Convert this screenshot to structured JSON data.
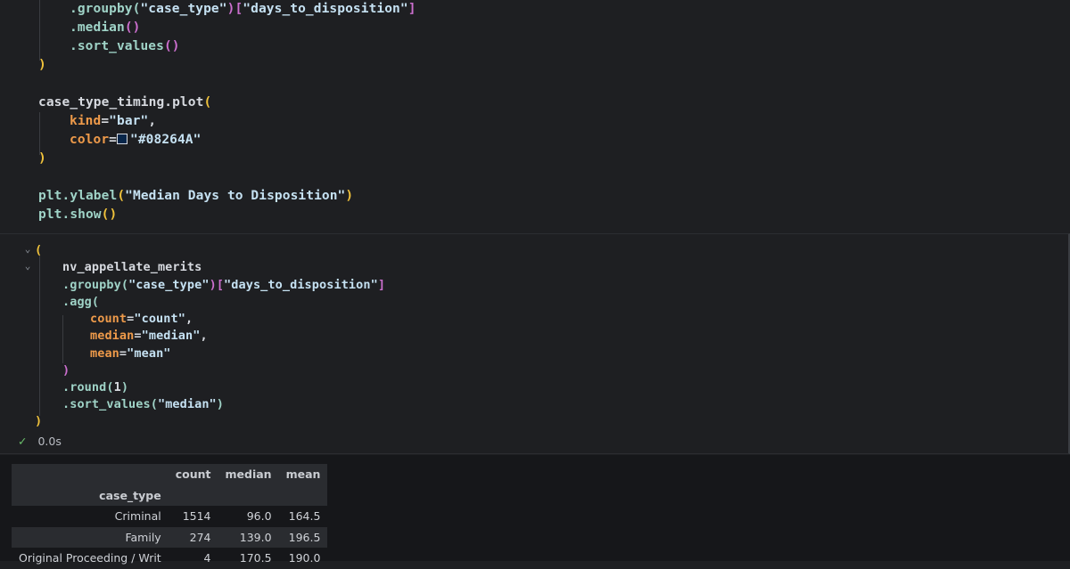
{
  "cell1": {
    "lines": [
      [
        ".groupby(",
        "\"case_type\"",
        ")",
        "[",
        "\"days_to_disposition\"",
        "]"
      ],
      [
        ".median",
        "()"
      ],
      [
        ".sort_values",
        "()"
      ],
      [
        ")"
      ],
      [
        "case_type_timing.plot",
        "("
      ],
      [
        "kind",
        "=",
        "\"bar\"",
        ","
      ],
      [
        "color",
        "=",
        "\"#08264A\""
      ],
      [
        ")"
      ],
      [
        "plt.ylabel",
        "(",
        "\"Median Days to Disposition\"",
        ")"
      ],
      [
        "plt.show",
        "()"
      ]
    ]
  },
  "cell2": {
    "lines": [
      [
        "("
      ],
      [
        "nv_appellate_merits"
      ],
      [
        ".groupby(",
        "\"case_type\"",
        ")",
        "[",
        "\"days_to_disposition\"",
        "]"
      ],
      [
        ".agg("
      ],
      [
        "count",
        "=",
        "\"count\"",
        ","
      ],
      [
        "median",
        "=",
        "\"median\"",
        ","
      ],
      [
        "mean",
        "=",
        "\"mean\""
      ],
      [
        ")"
      ],
      [
        ".round(",
        "1",
        ")"
      ],
      [
        ".sort_values(",
        "\"median\"",
        ")"
      ],
      [
        ")"
      ]
    ],
    "status_time": "0.0s"
  },
  "colors": {
    "swatch": "#08264A",
    "string": "#c5e1f2",
    "keyword": "#ee9a4a",
    "paren_yellow": "#f0c23b",
    "paren_purple": "#cc6fcf"
  },
  "table": {
    "columns": [
      "count",
      "median",
      "mean"
    ],
    "index_name": "case_type",
    "rows": [
      {
        "label": "Criminal",
        "count": "1514",
        "median": "96.0",
        "mean": "164.5"
      },
      {
        "label": "Family",
        "count": "274",
        "median": "139.0",
        "mean": "196.5"
      },
      {
        "label": "Original Proceeding / Writ",
        "count": "4",
        "median": "170.5",
        "mean": "190.0"
      }
    ]
  }
}
